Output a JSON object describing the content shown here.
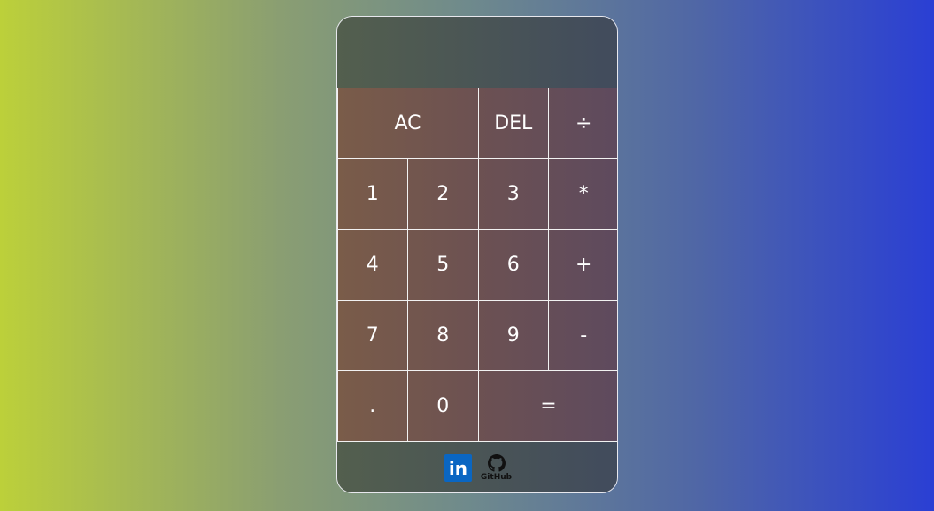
{
  "display": {
    "value": ""
  },
  "keys": [
    {
      "label": "AC",
      "name": "clear-button"
    },
    {
      "label": "DEL",
      "name": "delete-button"
    },
    {
      "label": "÷",
      "name": "divide-button"
    },
    {
      "label": "1",
      "name": "digit-1-button"
    },
    {
      "label": "2",
      "name": "digit-2-button"
    },
    {
      "label": "3",
      "name": "digit-3-button"
    },
    {
      "label": "*",
      "name": "multiply-button"
    },
    {
      "label": "4",
      "name": "digit-4-button"
    },
    {
      "label": "5",
      "name": "digit-5-button"
    },
    {
      "label": "6",
      "name": "digit-6-button"
    },
    {
      "label": "+",
      "name": "add-button"
    },
    {
      "label": "7",
      "name": "digit-7-button"
    },
    {
      "label": "8",
      "name": "digit-8-button"
    },
    {
      "label": "9",
      "name": "digit-9-button"
    },
    {
      "label": "-",
      "name": "subtract-button"
    },
    {
      "label": ".",
      "name": "decimal-button"
    },
    {
      "label": "0",
      "name": "digit-0-button"
    },
    {
      "label": "=",
      "name": "equals-button"
    }
  ],
  "footer": {
    "linkedin": {
      "text": "in",
      "icon": "linkedin-icon",
      "color": "#0a66c2"
    },
    "github": {
      "text": "GitHub",
      "icon": "github-icon"
    }
  }
}
